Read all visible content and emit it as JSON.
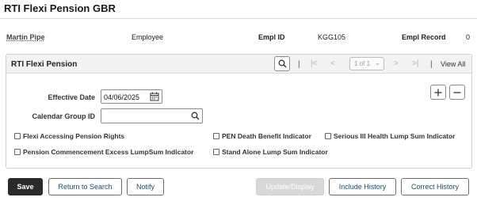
{
  "page": {
    "title": "RTI Flexi Pension GBR"
  },
  "employee": {
    "name": "Martin Pipe",
    "type": "Employee",
    "emplid_label": "Empl ID",
    "emplid": "KGG105",
    "emplrec_label": "Empl Record",
    "emplrec": "0"
  },
  "panel": {
    "title": "RTI Flexi Pension",
    "pagination": "1 of 1",
    "view_all": "View All",
    "icons": [
      "search-icon",
      "first-icon",
      "previous-icon",
      "next-icon",
      "last-icon",
      "add-icon",
      "delete-icon",
      "calendar-icon"
    ]
  },
  "form": {
    "effective_date_label": "Effective Date",
    "effective_date": "04/06/2025",
    "calendar_group_label": "Calendar Group ID",
    "calendar_group": ""
  },
  "checkboxes": [
    {
      "label": "Flexi Accessing Pension Rights",
      "checked": false
    },
    {
      "label": "PEN Death Benefit Indicator",
      "checked": false
    },
    {
      "label": "Serious Ill Health Lump Sum Indicator",
      "checked": false
    },
    {
      "label": "Pension Commencement Excess LumpSum Indicator",
      "checked": false
    },
    {
      "label": "Stand Alone Lump Sum Indicator",
      "checked": false
    }
  ],
  "buttons": {
    "save": "Save",
    "return": "Return to Search",
    "notify": "Notify",
    "update": "Update/Display",
    "include": "Include History",
    "correct": "Correct History"
  },
  "colors": {
    "link_blue": "#1a4a82",
    "save_bg": "#2b2b2b",
    "disabled_bg": "#d8d8d8"
  }
}
